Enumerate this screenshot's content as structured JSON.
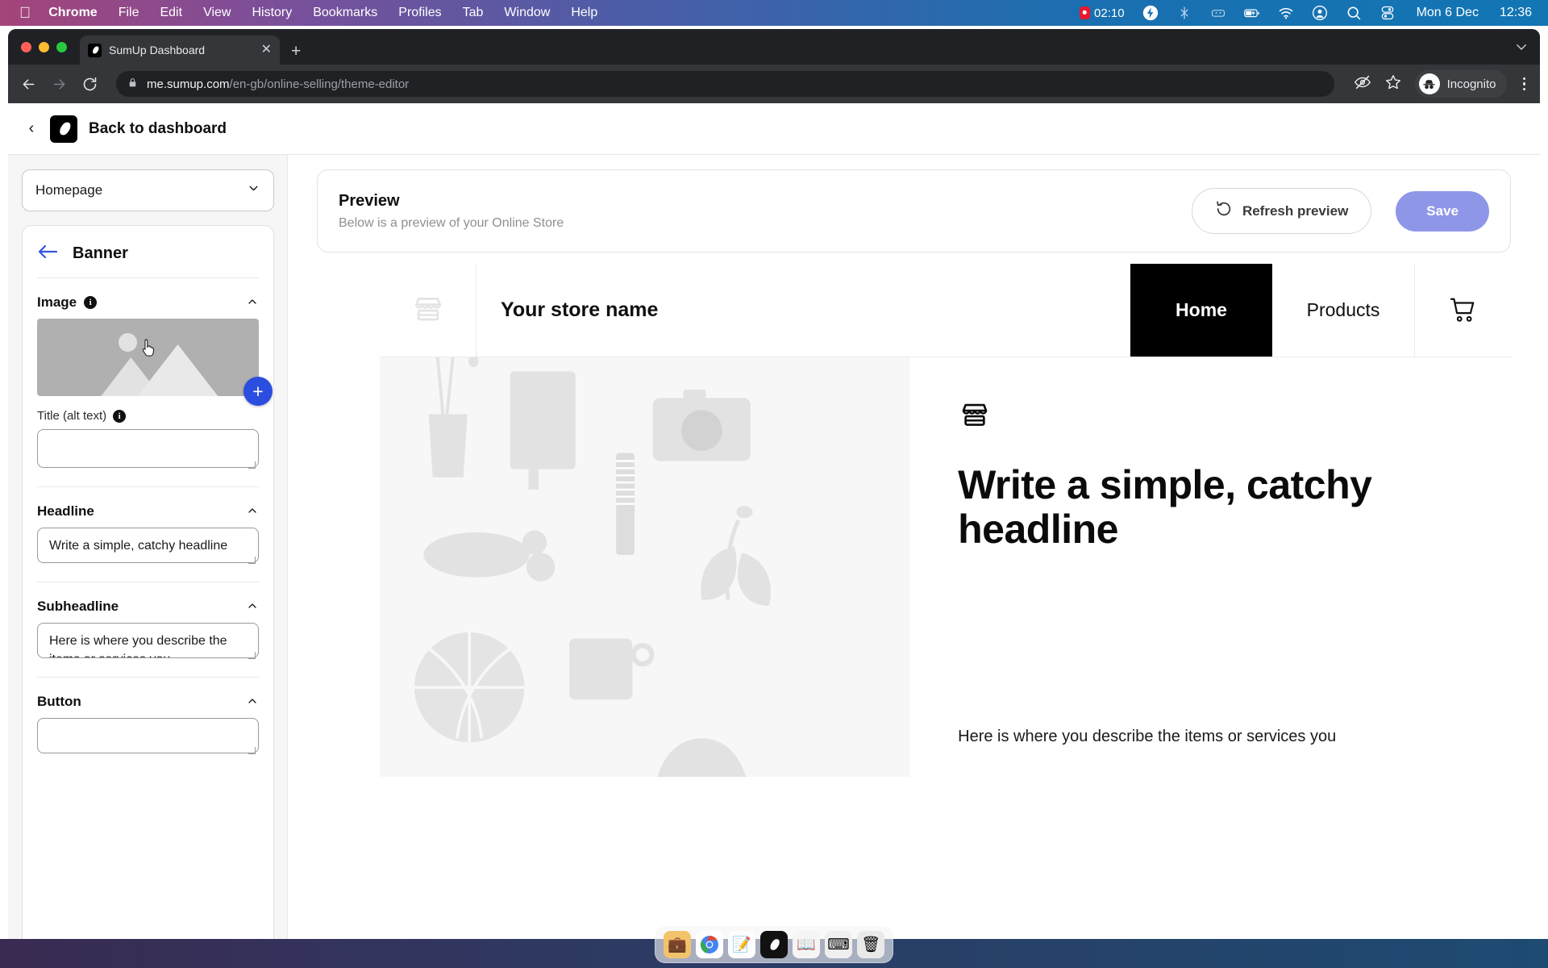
{
  "menubar": {
    "apple_icon": "apple-icon",
    "items": [
      {
        "label": "Chrome",
        "bold": true
      },
      {
        "label": "File",
        "bold": false
      },
      {
        "label": "Edit",
        "bold": false
      },
      {
        "label": "View",
        "bold": false
      },
      {
        "label": "History",
        "bold": false
      },
      {
        "label": "Bookmarks",
        "bold": false
      },
      {
        "label": "Profiles",
        "bold": false
      },
      {
        "label": "Tab",
        "bold": false
      },
      {
        "label": "Window",
        "bold": false
      },
      {
        "label": "Help",
        "bold": false
      }
    ],
    "recording_time": "02:10",
    "status_icons": [
      "bolt-icon",
      "bluetooth-off-icon",
      "dots-icon",
      "battery-charging-icon",
      "wifi-icon",
      "user-circle-icon",
      "search-icon",
      "control-center-icon"
    ],
    "date": "Mon 6 Dec",
    "time": "12:36"
  },
  "browser": {
    "tab": {
      "title": "SumUp Dashboard",
      "favicon": "sumup-logo-icon",
      "close_icon": "close-icon"
    },
    "new_tab_icon": "plus-icon",
    "tabstrip_chevron_icon": "chevron-down-icon",
    "nav": {
      "back_icon": "arrow-left-icon",
      "forward_icon": "arrow-right-icon",
      "reload_icon": "reload-icon"
    },
    "address": {
      "lock_icon": "lock-icon",
      "host": "me.sumup.com",
      "path": "/en-gb/online-selling/theme-editor",
      "full_url": "me.sumup.com/en-gb/online-selling/theme-editor"
    },
    "toolbar_icons": [
      "eye-off-icon",
      "star-icon"
    ],
    "profile": {
      "label": "Incognito",
      "avatar_icon": "incognito-icon"
    },
    "menu_icon": "kebab-menu-icon"
  },
  "app_header": {
    "back_chevron_icon": "chevron-left-icon",
    "logo_icon": "sumup-logo-icon",
    "title": "Back to dashboard"
  },
  "sidebar": {
    "page_select": {
      "value": "Homepage",
      "caret_icon": "chevron-down-icon"
    },
    "panel": {
      "back_arrow_icon": "arrow-left-icon",
      "title": "Banner",
      "sections": [
        {
          "id": "image",
          "label": "Image",
          "has_info": true,
          "info_icon": "info-icon",
          "collapse_icon": "chevron-up-icon",
          "add_image_icon": "plus-icon",
          "placeholder_icon": "image-placeholder-icon",
          "field_label": "Title (alt text)",
          "field_has_info": true,
          "field_value": ""
        },
        {
          "id": "headline",
          "label": "Headline",
          "has_info": false,
          "collapse_icon": "chevron-up-icon",
          "value": "Write a simple, catchy headline"
        },
        {
          "id": "subheadline",
          "label": "Subheadline",
          "has_info": false,
          "collapse_icon": "chevron-up-icon",
          "value": "Here is where you describe the items or services you"
        },
        {
          "id": "button",
          "label": "Button",
          "has_info": false,
          "collapse_icon": "chevron-up-icon",
          "value": ""
        }
      ]
    }
  },
  "preview_bar": {
    "title": "Preview",
    "subtitle": "Below is a preview of your Online Store",
    "refresh_button": {
      "label": "Refresh preview",
      "icon": "refresh-ccw-icon"
    },
    "save_button": {
      "label": "Save",
      "color": "#8e96e8",
      "disabled": true
    }
  },
  "store_preview": {
    "logo_icon": "storefront-icon",
    "store_name": "Your store name",
    "nav_tabs": [
      {
        "label": "Home",
        "active": true
      },
      {
        "label": "Products",
        "active": false
      }
    ],
    "cart_icon": "shopping-cart-icon",
    "hero": {
      "badge_icon": "storefront-icon",
      "headline": "Write a simple, catchy headline",
      "description": "Here is where you describe the items or services you"
    }
  },
  "dock": {
    "items": [
      "finder-icon",
      "chrome-icon",
      "notes-icon",
      "sumup-icon",
      "book-icon",
      "keyboard-icon",
      "trash-icon"
    ]
  },
  "colors": {
    "accent_blue": "#2b4de0",
    "save_button": "#8e96e8",
    "active_tab_bg": "#000000",
    "panel_bg": "#f6f6f6"
  }
}
